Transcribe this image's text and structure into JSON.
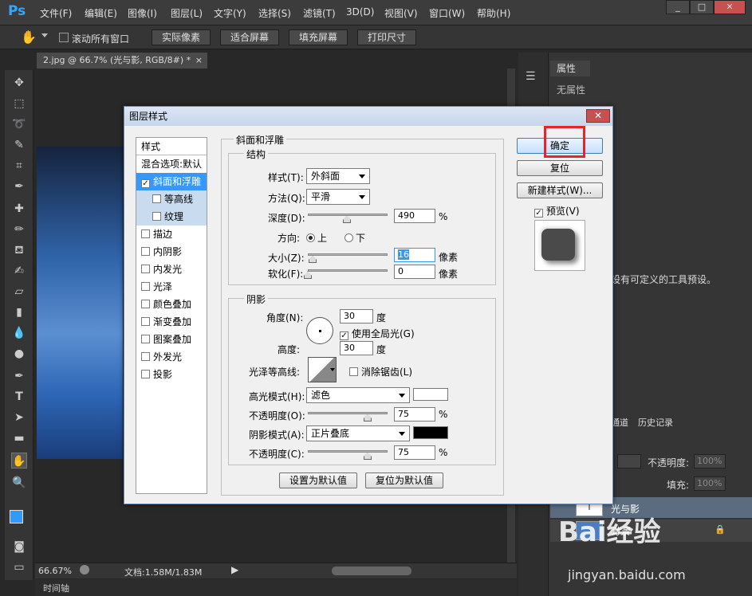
{
  "app": {
    "logo": "Ps"
  },
  "menus": [
    "文件(F)",
    "编辑(E)",
    "图像(I)",
    "图层(L)",
    "文字(Y)",
    "选择(S)",
    "滤镜(T)",
    "3D(D)",
    "视图(V)",
    "窗口(W)",
    "帮助(H)"
  ],
  "window_controls": [
    "_",
    "□",
    "✕"
  ],
  "options": {
    "scroll_all_label": "滚动所有窗口",
    "actual_pixels": "实际像素",
    "fit_screen": "适合屏幕",
    "fill_screen": "填充屏幕",
    "print_size": "打印尺寸"
  },
  "document": {
    "tab": "2.jpg @ 66.7% (光与影, RGB/8#) *",
    "close": "×"
  },
  "status": {
    "zoom": "66.67%",
    "doc_size": "文档:1.58M/1.83M",
    "timeline": "时间轴"
  },
  "panels": {
    "properties_tab": "属性",
    "no_properties": "无属性",
    "tool_preset_text": "设有可定义的工具预设。",
    "channels_tab": "通道",
    "history_tab": "历史记录",
    "opacity_label": "不透明度:",
    "opacity_value": "100%",
    "fill_label": "填充:",
    "fill_value": "100%",
    "layer_text_name": "光与影",
    "layer_text_thumb": "T",
    "layer_bg_name": "背景"
  },
  "dialog": {
    "title": "图层样式",
    "close": "✕",
    "styles_list": [
      {
        "label": "样式",
        "checkbox": false,
        "checked": false,
        "selected": false
      },
      {
        "label": "混合选项:默认",
        "checkbox": false,
        "checked": false,
        "selected": false
      },
      {
        "label": "斜面和浮雕",
        "checkbox": true,
        "checked": true,
        "selected": true
      },
      {
        "label": "等高线",
        "checkbox": true,
        "checked": false,
        "selected": false,
        "indent": true
      },
      {
        "label": "纹理",
        "checkbox": true,
        "checked": false,
        "selected": false,
        "indent": true
      },
      {
        "label": "描边",
        "checkbox": true,
        "checked": false,
        "selected": false
      },
      {
        "label": "内阴影",
        "checkbox": true,
        "checked": false,
        "selected": false
      },
      {
        "label": "内发光",
        "checkbox": true,
        "checked": false,
        "selected": false
      },
      {
        "label": "光泽",
        "checkbox": true,
        "checked": false,
        "selected": false
      },
      {
        "label": "颜色叠加",
        "checkbox": true,
        "checked": false,
        "selected": false
      },
      {
        "label": "渐变叠加",
        "checkbox": true,
        "checked": false,
        "selected": false
      },
      {
        "label": "图案叠加",
        "checkbox": true,
        "checked": false,
        "selected": false
      },
      {
        "label": "外发光",
        "checkbox": true,
        "checked": false,
        "selected": false
      },
      {
        "label": "投影",
        "checkbox": true,
        "checked": false,
        "selected": false
      }
    ],
    "bevel": {
      "group_title": "斜面和浮雕",
      "structure_title": "结构",
      "style_label": "样式(T):",
      "style_value": "外斜面",
      "technique_label": "方法(Q):",
      "technique_value": "平滑",
      "depth_label": "深度(D):",
      "depth_value": "490",
      "depth_fraction": 0.49,
      "pct": "%",
      "direction_label": "方向:",
      "dir_up": "上",
      "dir_down": "下",
      "size_label": "大小(Z):",
      "size_value": "16",
      "size_fraction": 0.06,
      "px": "像素",
      "soften_label": "软化(F):",
      "soften_value": "0",
      "soften_fraction": 0.0,
      "shading_title": "阴影",
      "angle_label": "角度(N):",
      "angle_value": "30",
      "deg": "度",
      "global_light_label": "使用全局光(G)",
      "altitude_label": "高度:",
      "altitude_value": "30",
      "gloss_label": "光泽等高线:",
      "antialias_label": "消除锯齿(L)",
      "highlight_mode_label": "高光模式(H):",
      "highlight_mode_value": "滤色",
      "highlight_color": "#ffffff",
      "highlight_opacity_label": "不透明度(O):",
      "highlight_opacity_value": "75",
      "highlight_opacity_fraction": 0.75,
      "shadow_mode_label": "阴影模式(A):",
      "shadow_mode_value": "正片叠底",
      "shadow_color": "#000000",
      "shadow_opacity_label": "不透明度(C):",
      "shadow_opacity_value": "75",
      "shadow_opacity_fraction": 0.75,
      "make_default": "设置为默认值",
      "reset_default": "复位为默认值"
    },
    "buttons": {
      "ok": "确定",
      "reset": "复位",
      "new_style": "新建样式(W)...",
      "preview": "预览(V)"
    }
  },
  "watermark": {
    "line1": "Bai经验",
    "line2": "jingyan.baidu.com"
  },
  "colors": {
    "accent": "#3399ff",
    "highlight_box": "#e8232a",
    "list_selected": "#3399ff"
  }
}
